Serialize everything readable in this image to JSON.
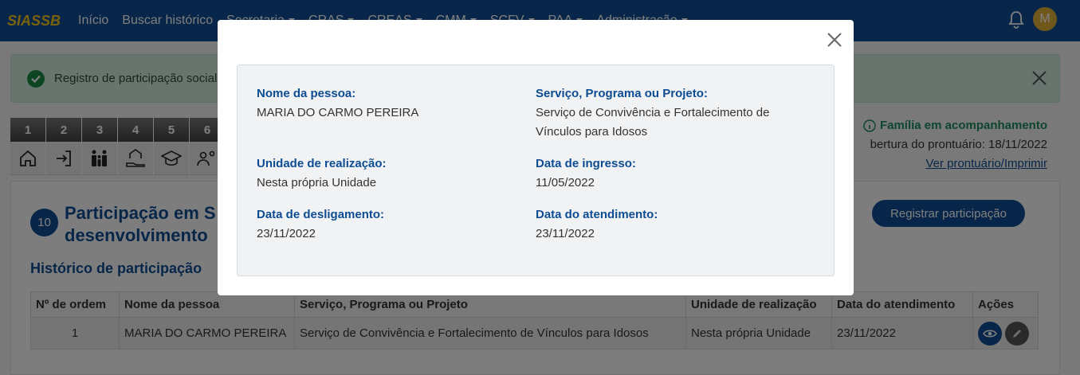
{
  "navbar": {
    "brand": "SIASSB",
    "links": [
      "Início",
      "Buscar histórico"
    ],
    "dropdowns": [
      "Secretaria",
      "CRAS",
      "CREAS",
      "CMM",
      "SCFV",
      "PAA",
      "Administração"
    ],
    "avatar_initial": "M"
  },
  "alert": {
    "text": "Registro de participação social"
  },
  "steps": [
    {
      "number": "1",
      "icon": "home-icon"
    },
    {
      "number": "2",
      "icon": "login-icon"
    },
    {
      "number": "3",
      "icon": "family-icon"
    },
    {
      "number": "4",
      "icon": "house-hand-icon"
    },
    {
      "number": "5",
      "icon": "graduation-cap-icon"
    },
    {
      "number": "6",
      "icon": "people-gear-icon"
    }
  ],
  "family": {
    "status": "Família em acompanhamento",
    "opening": "bertura do prontuário: 18/11/2022",
    "record_link": "Ver prontuário/Imprimir"
  },
  "section": {
    "number": "10",
    "title_line1": "Participação em S",
    "title_line2": "desenvolvimento",
    "register_button": "Registrar participação",
    "history_title": "Histórico de participação"
  },
  "table": {
    "headers": [
      "Nº de ordem",
      "Nome da pessoa",
      "Serviço, Programa ou Projeto",
      "Unidade de realização",
      "Data do atendimento",
      "Ações"
    ],
    "rows": [
      {
        "order": "1",
        "name": "MARIA DO CARMO PEREIRA",
        "service": "Serviço de Convivência e Fortalecimento de Vínculos para Idosos",
        "unit": "Nesta própria Unidade",
        "date": "23/11/2022"
      }
    ]
  },
  "modal": {
    "fields": {
      "name_label": "Nome da pessoa:",
      "name_value": "MARIA DO CARMO PEREIRA",
      "service_label": "Serviço, Programa ou Projeto:",
      "service_value_line1": "Serviço de Convivência e Fortalecimento de",
      "service_value_line2": "Vínculos para Idosos",
      "unit_label": "Unidade de realização:",
      "unit_value": "Nesta própria Unidade",
      "entry_label": "Data de ingresso:",
      "entry_value": "11/05/2022",
      "exit_label": "Data de desligamento:",
      "exit_value": "23/11/2022",
      "service_date_label": "Data do atendimento:",
      "service_date_value": "23/11/2022"
    }
  },
  "colors": {
    "primary": "#0e4c92",
    "brand": "#f5c518",
    "success": "#1a8a46"
  }
}
